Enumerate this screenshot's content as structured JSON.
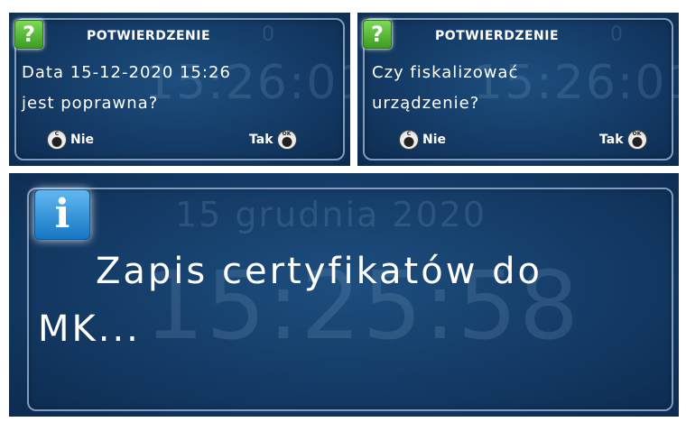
{
  "dialog_date": {
    "title": "POTWIERDZENIE",
    "title_bg_digit": "0",
    "line1": "Data  15-12-2020  15:26",
    "line2": "jest  poprawna?",
    "bg_clock": "15:26:01",
    "button_no": {
      "label": "Nie",
      "key_label": "C"
    },
    "button_yes": {
      "label": "Tak",
      "key_label": "OK"
    },
    "icon": "question-icon"
  },
  "dialog_fiscal": {
    "title": "POTWIERDZENIE",
    "title_bg_digit": "0",
    "line1": "Czy  fiskalizować",
    "line2": "urządzenie?",
    "bg_clock": "15:26:01",
    "button_no": {
      "label": "Nie",
      "key_label": "C"
    },
    "button_yes": {
      "label": "Tak",
      "key_label": "OK"
    },
    "icon": "question-icon"
  },
  "info_panel": {
    "bg_date": "15  grudnia  2020",
    "bg_clock": "15:25:58",
    "line1": "Zapis  certyfikatów  do",
    "line2": "MK...",
    "icon": "info-icon"
  },
  "colors": {
    "panel_bg": "#143b66",
    "border": "#7f9bbd",
    "question_icon": "#4caf2f",
    "info_icon": "#1e88d6"
  }
}
